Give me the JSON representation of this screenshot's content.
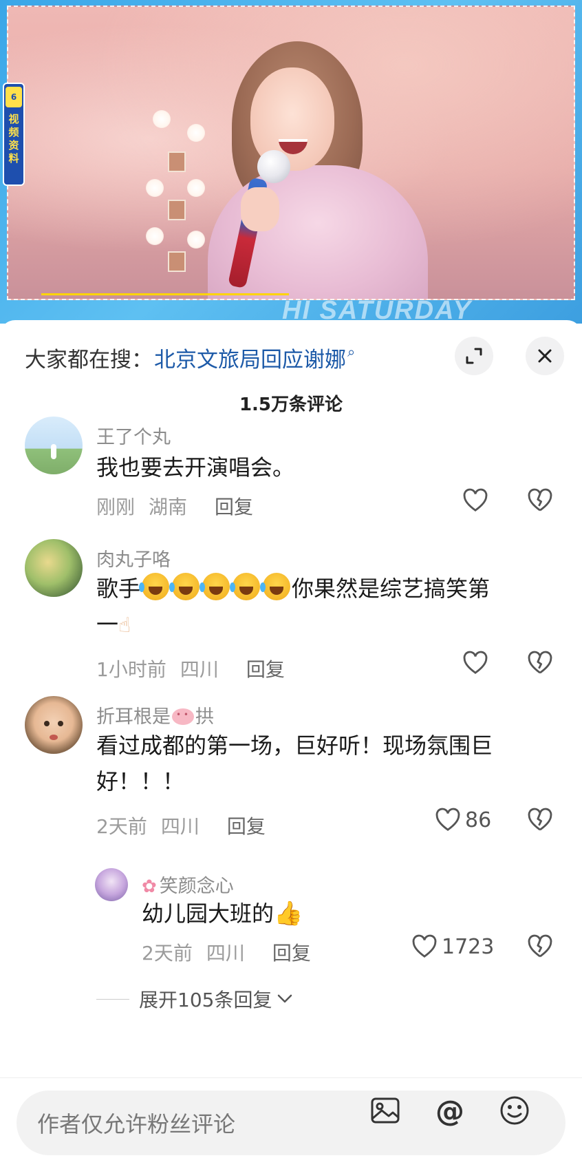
{
  "video": {
    "side_tag_top": "6",
    "side_tag_chars": [
      "视",
      "频",
      "资",
      "料"
    ],
    "watermark": "HI SATURDAY"
  },
  "search": {
    "prefix": "大家都在搜：",
    "term": "北京文旅局回应谢娜",
    "glass": "⚲"
  },
  "icons": {
    "expand": "expand-icon",
    "close": "close-icon",
    "heart": "heart-icon",
    "dislike": "broken-heart-icon",
    "image": "image-icon",
    "at": "at-icon",
    "emoji": "smile-icon"
  },
  "comments_count": "1.5万条评论",
  "comments": [
    {
      "user": "王了个丸",
      "text": "我也要去开演唱会。",
      "time": "刚刚",
      "location": "湖南",
      "reply": "回复",
      "likes": ""
    },
    {
      "user": "肉丸子咯",
      "text_prefix": "歌手",
      "text_suffix": "你果然是综艺搞笑第",
      "text_line2": "一",
      "time": "1小时前",
      "location": "四川",
      "reply": "回复",
      "likes": ""
    },
    {
      "user_prefix": "折耳根是",
      "user_suffix": "拱",
      "text": "看过成都的第一场，巨好听！现场氛围巨好！！！",
      "time": "2天前",
      "location": "四川",
      "reply": "回复",
      "likes": "86"
    }
  ],
  "sub_reply": {
    "user": "笑颜念心",
    "text": "幼儿园大班的",
    "time": "2天前",
    "location": "四川",
    "reply": "回复",
    "likes": "1723"
  },
  "expand_replies": "展开105条回复",
  "input": {
    "placeholder": "作者仅允许粉丝评论"
  },
  "colors": {
    "search_term": "#1d5aa8",
    "video_border": "#3aa6e8"
  }
}
